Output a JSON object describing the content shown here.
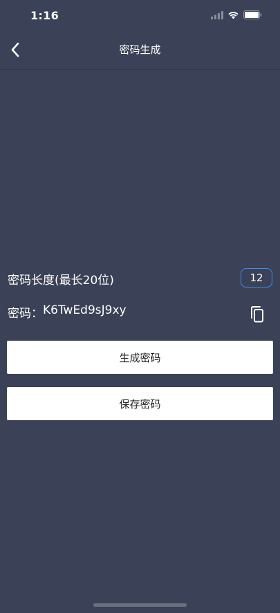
{
  "status_bar": {
    "time": "1:16",
    "icons": [
      "signal-icon",
      "wifi-icon",
      "battery-icon"
    ]
  },
  "nav": {
    "title": "密码生成",
    "back_icon": "chevron-left-icon"
  },
  "form": {
    "length_label": "密码长度(最长20位)",
    "length_value": "12",
    "password_label": "密码：",
    "password_value": "K6TwEd9sJ9xy",
    "copy_icon": "copy-icon"
  },
  "buttons": {
    "generate_label": "生成密码",
    "save_label": "保存密码"
  },
  "colors": {
    "background": "#3b4257",
    "accent": "#3c8cf0",
    "button_bg": "#ffffff",
    "button_text": "#222222"
  }
}
